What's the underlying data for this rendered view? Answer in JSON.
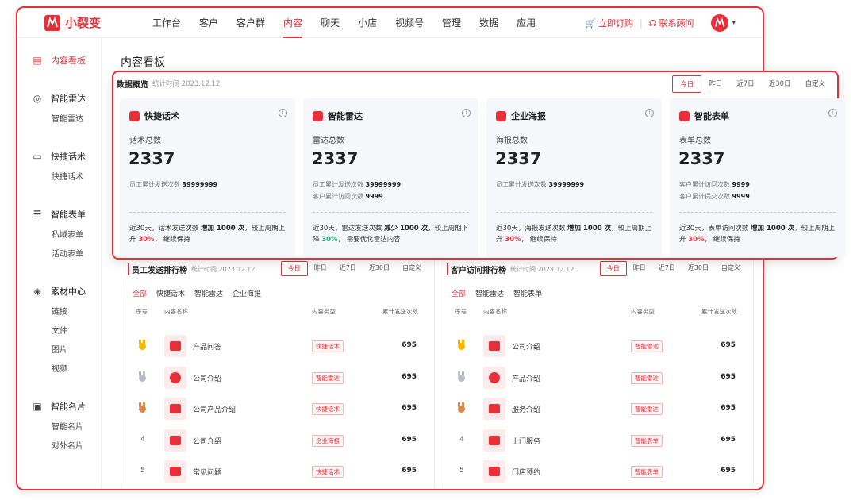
{
  "brand": {
    "name": "小裂变"
  },
  "nav": [
    "工作台",
    "客户",
    "客户群",
    "内容",
    "聊天",
    "小店",
    "视频号",
    "管理",
    "数据",
    "应用"
  ],
  "nav_active": "内容",
  "top_right": {
    "order": "立即订购",
    "contact": "联系顾问"
  },
  "sidebar": {
    "content_board": "内容看板",
    "groups": [
      {
        "label": "智能雷达",
        "items": [
          "智能雷达"
        ]
      },
      {
        "label": "快捷话术",
        "items": [
          "快捷话术"
        ]
      },
      {
        "label": "智能表单",
        "items": [
          "私域表单",
          "活动表单"
        ]
      },
      {
        "label": "素材中心",
        "items": [
          "链接",
          "文件",
          "图片",
          "视频"
        ]
      },
      {
        "label": "智能名片",
        "items": [
          "智能名片",
          "对外名片"
        ]
      }
    ]
  },
  "main": {
    "title": "内容看板"
  },
  "overview": {
    "title": "数据概览",
    "time": "统计时间 2023.12.12",
    "tabs": [
      "今日",
      "昨日",
      "近7日",
      "近30日",
      "自定义"
    ],
    "active_tab": "今日",
    "cards": [
      {
        "title": "快捷话术",
        "label": "话术总数",
        "total": "2337",
        "stat1_label": "员工累计发送次数",
        "stat1_value": "39999999",
        "stat2_label": "",
        "stat2_value": "",
        "foot_pre": "近30天，话术发送次数",
        "foot_change": "增加 1000 次",
        "foot_mid": "，较上周期上升",
        "foot_pct": "30%",
        "foot_post": "， 继续保持",
        "trend": "up"
      },
      {
        "title": "智能雷达",
        "label": "雷达总数",
        "total": "2337",
        "stat1_label": "员工累计发送次数",
        "stat1_value": "39999999",
        "stat2_label": "客户累计访问次数",
        "stat2_value": "9999",
        "foot_pre": "近30天，雷达发送次数",
        "foot_change": "减少 1000 次",
        "foot_mid": "，较上周期下降",
        "foot_pct": "30%",
        "foot_post": "， 需要优化雷达内容",
        "trend": "down"
      },
      {
        "title": "企业海报",
        "label": "海报总数",
        "total": "2337",
        "stat1_label": "员工累计发送次数",
        "stat1_value": "39999999",
        "stat2_label": "",
        "stat2_value": "",
        "foot_pre": "近30天，海报发送次数",
        "foot_change": "增加 1000 次",
        "foot_mid": "，较上周期上升",
        "foot_pct": "30%",
        "foot_post": "， 继续保持",
        "trend": "up"
      },
      {
        "title": "智能表单",
        "label": "表单总数",
        "total": "2337",
        "stat1_label": "客户累计访问次数",
        "stat1_value": "9999",
        "stat2_label": "客户累计提交次数",
        "stat2_value": "9999",
        "foot_pre": "近30天，表单访问次数",
        "foot_change": "增加 1000 次",
        "foot_mid": "，较上周期上升",
        "foot_pct": "30%",
        "foot_post": "， 继续保持",
        "trend": "up"
      }
    ]
  },
  "rankings": [
    {
      "title": "员工发送排行榜",
      "time": "统计时间 2023.12.12",
      "tabs": [
        "今日",
        "昨日",
        "近7日",
        "近30日",
        "自定义"
      ],
      "active_tab": "今日",
      "filters": [
        "全部",
        "快捷话术",
        "智能雷达",
        "企业海报"
      ],
      "active_filter": "全部",
      "headers": {
        "rank": "序号",
        "name": "内容名称",
        "type": "内容类型",
        "count": "累计发送次数"
      },
      "rows": [
        {
          "rank": "1",
          "name": "产品问答",
          "type": "快捷话术",
          "count": "695",
          "icon": "chat-icon"
        },
        {
          "rank": "2",
          "name": "公司介绍",
          "type": "智能雷达",
          "count": "695",
          "icon": "radar-icon"
        },
        {
          "rank": "3",
          "name": "公司产品介绍",
          "type": "快捷话术",
          "count": "695",
          "icon": "chat-icon"
        },
        {
          "rank": "4",
          "name": "公司介绍",
          "type": "企业海报",
          "count": "695",
          "icon": "poster-icon"
        },
        {
          "rank": "5",
          "name": "常见问题",
          "type": "快捷话术",
          "count": "695",
          "icon": "chat-icon"
        }
      ]
    },
    {
      "title": "客户访问排行榜",
      "time": "统计时间 2023.12.12",
      "tabs": [
        "今日",
        "昨日",
        "近7日",
        "近30日",
        "自定义"
      ],
      "active_tab": "今日",
      "filters": [
        "全部",
        "智能雷达",
        "智能表单"
      ],
      "active_filter": "全部",
      "headers": {
        "rank": "序号",
        "name": "内容名称",
        "type": "内容类型",
        "count": "累计发送次数"
      },
      "rows": [
        {
          "rank": "1",
          "name": "公司介绍",
          "type": "智能雷达",
          "count": "695",
          "icon": "chat-icon"
        },
        {
          "rank": "2",
          "name": "产品介绍",
          "type": "智能雷达",
          "count": "695",
          "icon": "radar-icon"
        },
        {
          "rank": "3",
          "name": "服务介绍",
          "type": "智能雷达",
          "count": "695",
          "icon": "chat-icon"
        },
        {
          "rank": "4",
          "name": "上门服务",
          "type": "智能表单",
          "count": "695",
          "icon": "poster-icon"
        },
        {
          "rank": "5",
          "name": "门店预约",
          "type": "智能表单",
          "count": "695",
          "icon": "chat-icon"
        }
      ]
    }
  ],
  "colors": {
    "accent": "#e8303a",
    "down": "#1fb36b",
    "gold": "#f5b800",
    "silver": "#b9bdc6",
    "bronze": "#d9894a"
  }
}
